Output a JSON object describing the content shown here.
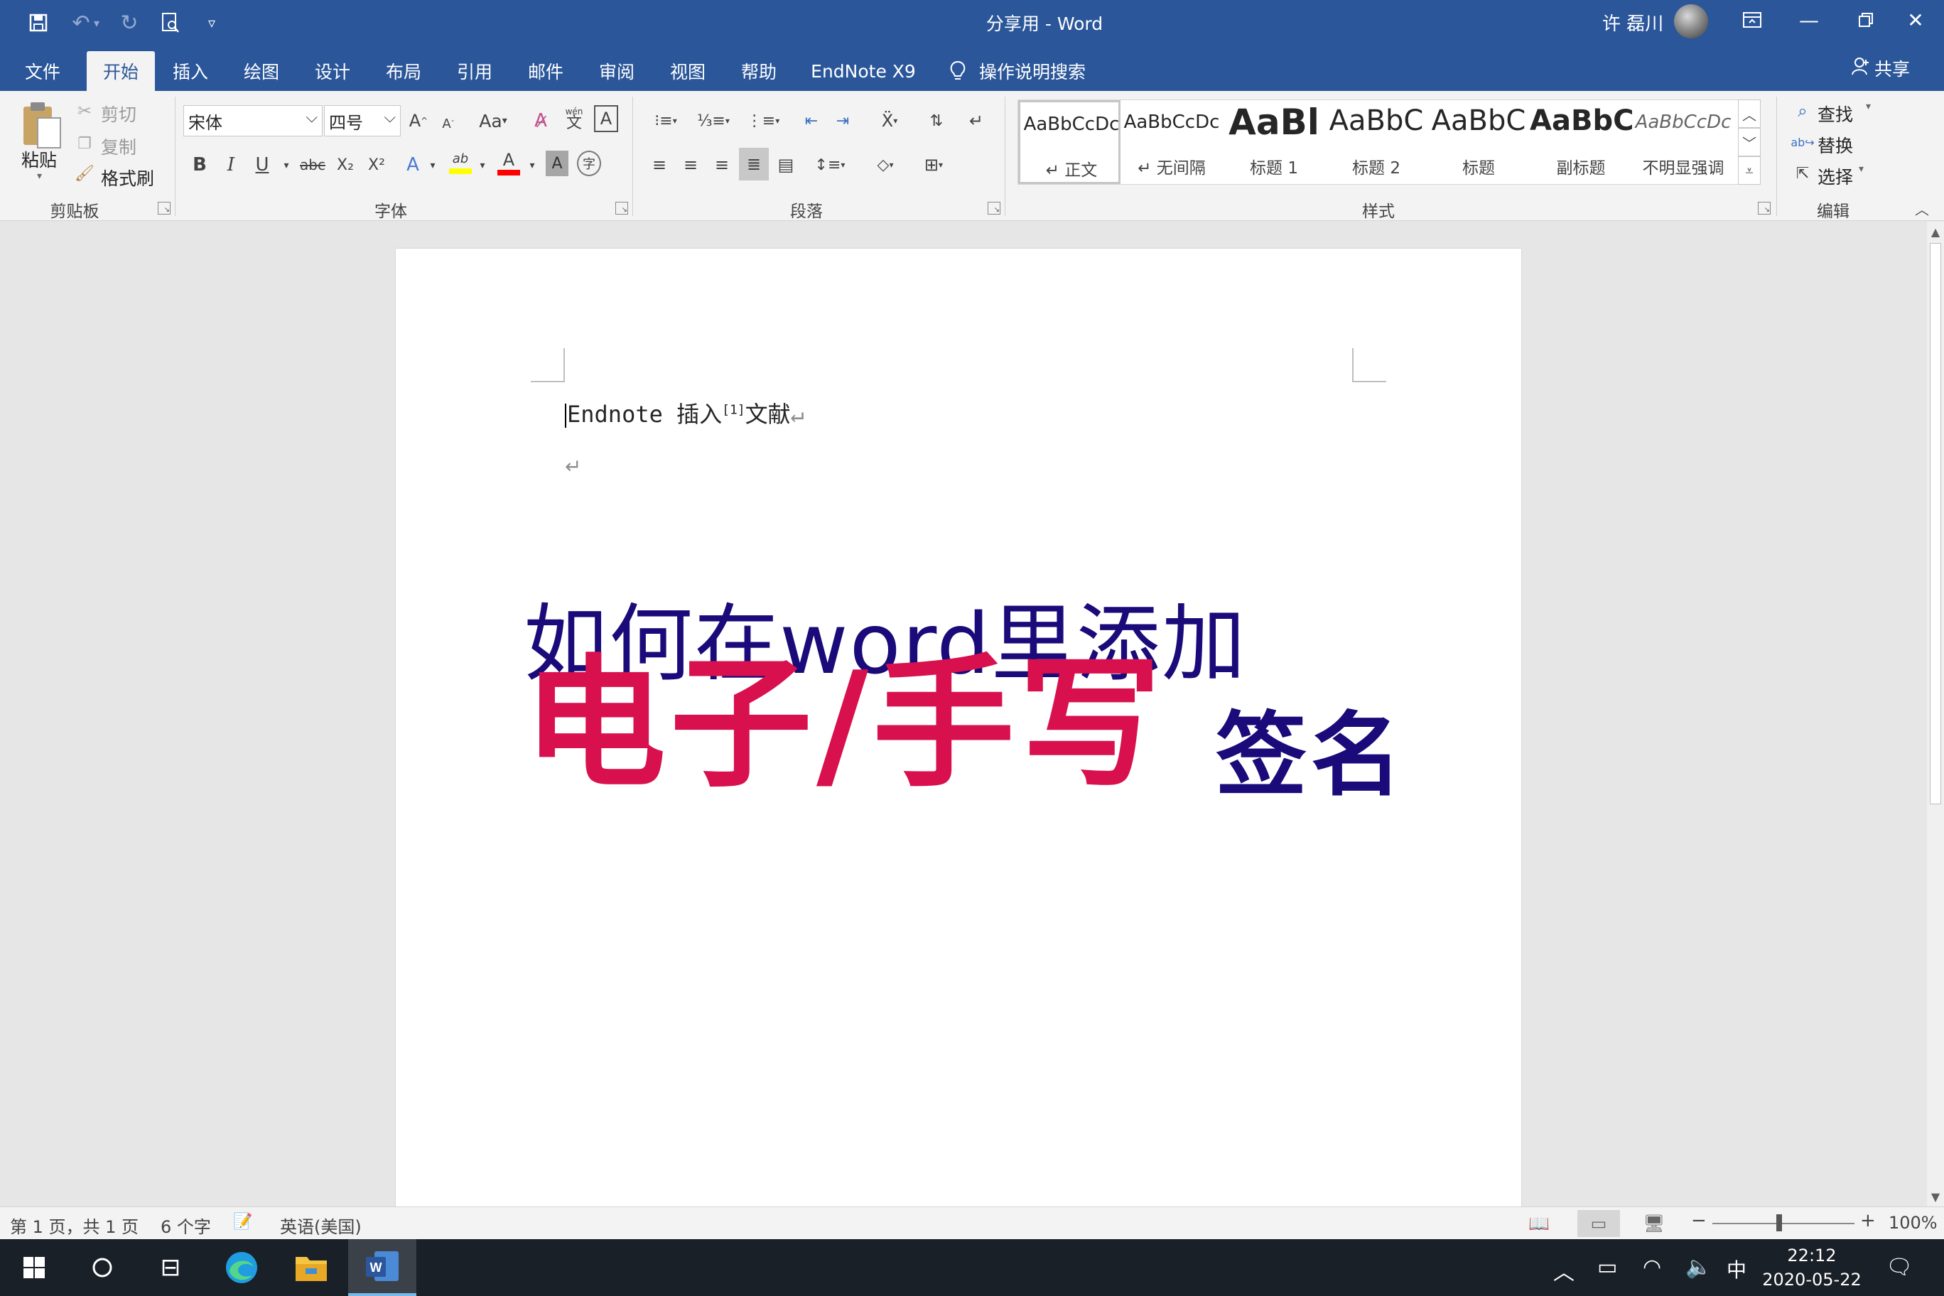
{
  "titlebar": {
    "doc_title": "分享用  -  Word",
    "user_name": "许 磊川",
    "quick_access": [
      "save-icon",
      "undo-icon",
      "redo-icon",
      "print-preview-icon",
      "customize-icon"
    ],
    "window_buttons": [
      "ribbon-display-icon",
      "minimize-icon",
      "restore-icon",
      "close-icon"
    ]
  },
  "menu": {
    "tabs": [
      "文件",
      "开始",
      "插入",
      "绘图",
      "设计",
      "布局",
      "引用",
      "邮件",
      "审阅",
      "视图",
      "帮助",
      "EndNote X9"
    ],
    "active_tab": "开始",
    "tell_me": "操作说明搜索",
    "share": "共享"
  },
  "clipboard": {
    "paste": "粘贴",
    "cut": "剪切",
    "copy": "复制",
    "format_painter": "格式刷",
    "label": "剪贴板"
  },
  "font": {
    "name": "宋体",
    "size": "四号",
    "label": "字体",
    "grow": "A",
    "shrink": "A",
    "change_case": "Aa",
    "phonetic": "wén",
    "bold": "B",
    "italic": "I",
    "underline": "U",
    "strike": "abc",
    "subscript": "X₂",
    "superscript": "X²",
    "text_effects": "A",
    "highlight": "ab",
    "font_color": "A",
    "char_shading": "A",
    "enclose": "字",
    "highlight_color": "#ffff00",
    "font_color_value": "#ff0000"
  },
  "paragraph": {
    "label": "段落"
  },
  "styles": {
    "label": "样式",
    "items": [
      {
        "preview": "AaBbCcDc",
        "name": "↵ 正文"
      },
      {
        "preview": "AaBbCcDc",
        "name": "↵ 无间隔"
      },
      {
        "preview": "AaBl",
        "name": "标题 1"
      },
      {
        "preview": "AaBbC",
        "name": "标题 2"
      },
      {
        "preview": "AaBbC",
        "name": "标题"
      },
      {
        "preview": "AaBbC",
        "name": "副标题"
      },
      {
        "preview": "AaBbCcDc",
        "name": "不明显强调"
      }
    ]
  },
  "editing": {
    "find": "查找",
    "replace": "替换",
    "select": "选择",
    "label": "编辑"
  },
  "document": {
    "line1_text": "Endnote 插入",
    "citation": "[1]",
    "line1_tail": "文献",
    "pilcrow": "↵",
    "overlay_line1": "如何在word里添加",
    "overlay_line2": "电子/手写",
    "overlay_line3": "签名",
    "colors": {
      "navy": "#1a0a7a",
      "crimson": "#d8104e"
    }
  },
  "status": {
    "page": "第 1 页，共 1 页",
    "words": "6 个字",
    "language": "英语(美国)",
    "zoom": "100%",
    "zoom_level_percent": 100
  },
  "taskbar": {
    "time": "22:12",
    "date": "2020-05-22",
    "ime": "中"
  }
}
